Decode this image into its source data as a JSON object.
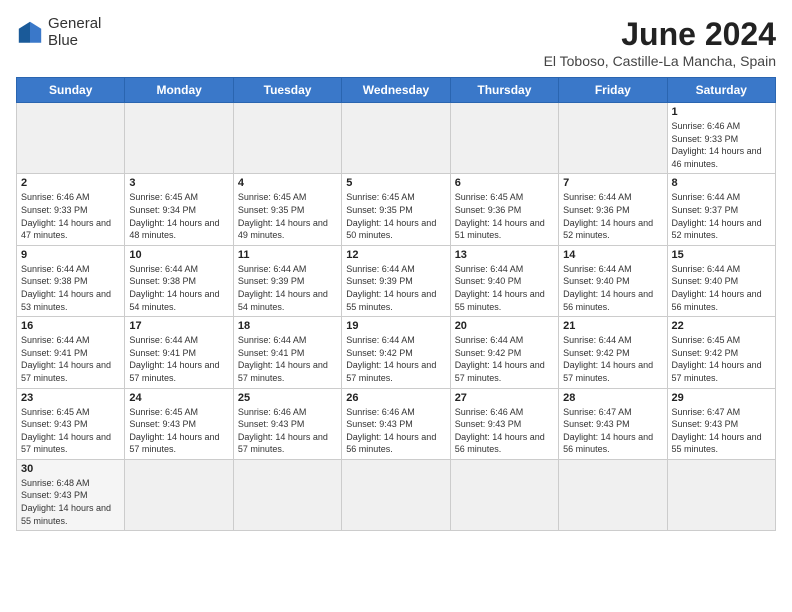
{
  "header": {
    "logo_line1": "General",
    "logo_line2": "Blue",
    "title": "June 2024",
    "location": "El Toboso, Castille-La Mancha, Spain"
  },
  "weekdays": [
    "Sunday",
    "Monday",
    "Tuesday",
    "Wednesday",
    "Thursday",
    "Friday",
    "Saturday"
  ],
  "weeks": [
    [
      {
        "day": "",
        "info": ""
      },
      {
        "day": "",
        "info": ""
      },
      {
        "day": "",
        "info": ""
      },
      {
        "day": "",
        "info": ""
      },
      {
        "day": "",
        "info": ""
      },
      {
        "day": "",
        "info": ""
      },
      {
        "day": "1",
        "info": "Sunrise: 6:46 AM\nSunset: 9:33 PM\nDaylight: 14 hours and 46 minutes."
      }
    ],
    [
      {
        "day": "2",
        "info": "Sunrise: 6:46 AM\nSunset: 9:33 PM\nDaylight: 14 hours and 47 minutes."
      },
      {
        "day": "3",
        "info": "Sunrise: 6:45 AM\nSunset: 9:34 PM\nDaylight: 14 hours and 48 minutes."
      },
      {
        "day": "4",
        "info": "Sunrise: 6:45 AM\nSunset: 9:35 PM\nDaylight: 14 hours and 49 minutes."
      },
      {
        "day": "5",
        "info": "Sunrise: 6:45 AM\nSunset: 9:35 PM\nDaylight: 14 hours and 50 minutes."
      },
      {
        "day": "6",
        "info": "Sunrise: 6:45 AM\nSunset: 9:36 PM\nDaylight: 14 hours and 51 minutes."
      },
      {
        "day": "7",
        "info": "Sunrise: 6:44 AM\nSunset: 9:36 PM\nDaylight: 14 hours and 52 minutes."
      },
      {
        "day": "8",
        "info": "Sunrise: 6:44 AM\nSunset: 9:37 PM\nDaylight: 14 hours and 52 minutes."
      }
    ],
    [
      {
        "day": "9",
        "info": "Sunrise: 6:44 AM\nSunset: 9:38 PM\nDaylight: 14 hours and 53 minutes."
      },
      {
        "day": "10",
        "info": "Sunrise: 6:44 AM\nSunset: 9:38 PM\nDaylight: 14 hours and 54 minutes."
      },
      {
        "day": "11",
        "info": "Sunrise: 6:44 AM\nSunset: 9:39 PM\nDaylight: 14 hours and 54 minutes."
      },
      {
        "day": "12",
        "info": "Sunrise: 6:44 AM\nSunset: 9:39 PM\nDaylight: 14 hours and 55 minutes."
      },
      {
        "day": "13",
        "info": "Sunrise: 6:44 AM\nSunset: 9:40 PM\nDaylight: 14 hours and 55 minutes."
      },
      {
        "day": "14",
        "info": "Sunrise: 6:44 AM\nSunset: 9:40 PM\nDaylight: 14 hours and 56 minutes."
      },
      {
        "day": "15",
        "info": "Sunrise: 6:44 AM\nSunset: 9:40 PM\nDaylight: 14 hours and 56 minutes."
      }
    ],
    [
      {
        "day": "16",
        "info": "Sunrise: 6:44 AM\nSunset: 9:41 PM\nDaylight: 14 hours and 57 minutes."
      },
      {
        "day": "17",
        "info": "Sunrise: 6:44 AM\nSunset: 9:41 PM\nDaylight: 14 hours and 57 minutes."
      },
      {
        "day": "18",
        "info": "Sunrise: 6:44 AM\nSunset: 9:41 PM\nDaylight: 14 hours and 57 minutes."
      },
      {
        "day": "19",
        "info": "Sunrise: 6:44 AM\nSunset: 9:42 PM\nDaylight: 14 hours and 57 minutes."
      },
      {
        "day": "20",
        "info": "Sunrise: 6:44 AM\nSunset: 9:42 PM\nDaylight: 14 hours and 57 minutes."
      },
      {
        "day": "21",
        "info": "Sunrise: 6:44 AM\nSunset: 9:42 PM\nDaylight: 14 hours and 57 minutes."
      },
      {
        "day": "22",
        "info": "Sunrise: 6:45 AM\nSunset: 9:42 PM\nDaylight: 14 hours and 57 minutes."
      }
    ],
    [
      {
        "day": "23",
        "info": "Sunrise: 6:45 AM\nSunset: 9:43 PM\nDaylight: 14 hours and 57 minutes."
      },
      {
        "day": "24",
        "info": "Sunrise: 6:45 AM\nSunset: 9:43 PM\nDaylight: 14 hours and 57 minutes."
      },
      {
        "day": "25",
        "info": "Sunrise: 6:46 AM\nSunset: 9:43 PM\nDaylight: 14 hours and 57 minutes."
      },
      {
        "day": "26",
        "info": "Sunrise: 6:46 AM\nSunset: 9:43 PM\nDaylight: 14 hours and 56 minutes."
      },
      {
        "day": "27",
        "info": "Sunrise: 6:46 AM\nSunset: 9:43 PM\nDaylight: 14 hours and 56 minutes."
      },
      {
        "day": "28",
        "info": "Sunrise: 6:47 AM\nSunset: 9:43 PM\nDaylight: 14 hours and 56 minutes."
      },
      {
        "day": "29",
        "info": "Sunrise: 6:47 AM\nSunset: 9:43 PM\nDaylight: 14 hours and 55 minutes."
      }
    ],
    [
      {
        "day": "30",
        "info": "Sunrise: 6:48 AM\nSunset: 9:43 PM\nDaylight: 14 hours and 55 minutes."
      },
      {
        "day": "",
        "info": ""
      },
      {
        "day": "",
        "info": ""
      },
      {
        "day": "",
        "info": ""
      },
      {
        "day": "",
        "info": ""
      },
      {
        "day": "",
        "info": ""
      },
      {
        "day": "",
        "info": ""
      }
    ]
  ]
}
